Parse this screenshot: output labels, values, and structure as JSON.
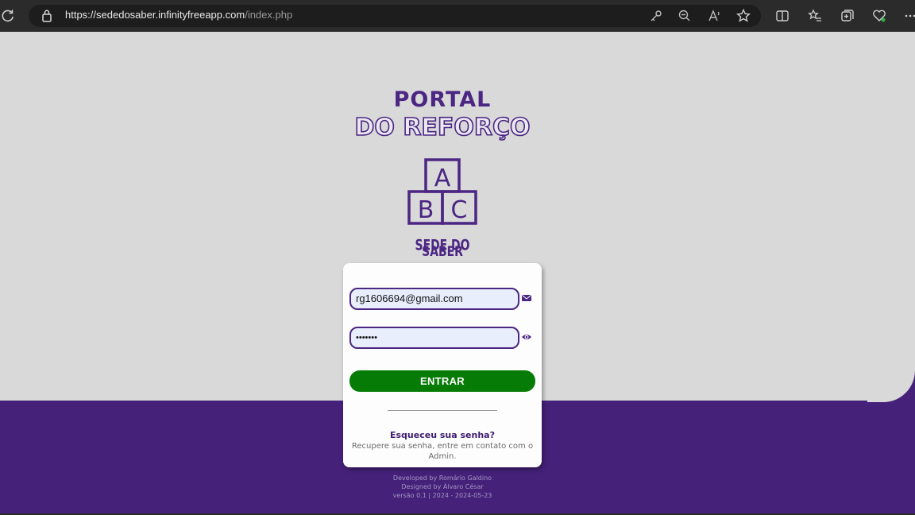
{
  "browser": {
    "url_host": "https://sededosaber.infinityfreeapp.com",
    "url_path": "/index.php",
    "icons": [
      "refresh-icon",
      "lock-icon",
      "key-icon",
      "zoom-out-icon",
      "read-aloud-icon",
      "favorite-star-icon",
      "split-screen-icon",
      "favorites-list-icon",
      "collections-icon",
      "browser-essentials-icon",
      "more-icon"
    ]
  },
  "header": {
    "title_line1": "PORTAL",
    "title_line2": "DO REFORÇO"
  },
  "logo": {
    "blocks": [
      "A",
      "B",
      "C"
    ],
    "text_line1": "SEDE DO",
    "text_line2": "SABER"
  },
  "login": {
    "email_value": "rg1606694@gmail.com",
    "password_masked": "•••••••",
    "submit_label": "ENTRAR",
    "forgot_title": "Esqueceu sua senha?",
    "forgot_text": "Recupere sua senha, entre em contato com o Admin."
  },
  "footer": {
    "developed_by": "Developed by Romário Galdino",
    "designed_by": "Designed by Álvaro César",
    "version": "versão 0.1 | 2024 - 2024-05-23"
  },
  "colors": {
    "brand_purple": "#4b2683",
    "band_purple": "#45217a",
    "button_green": "#067c06",
    "page_bg": "#d9d9d9"
  }
}
